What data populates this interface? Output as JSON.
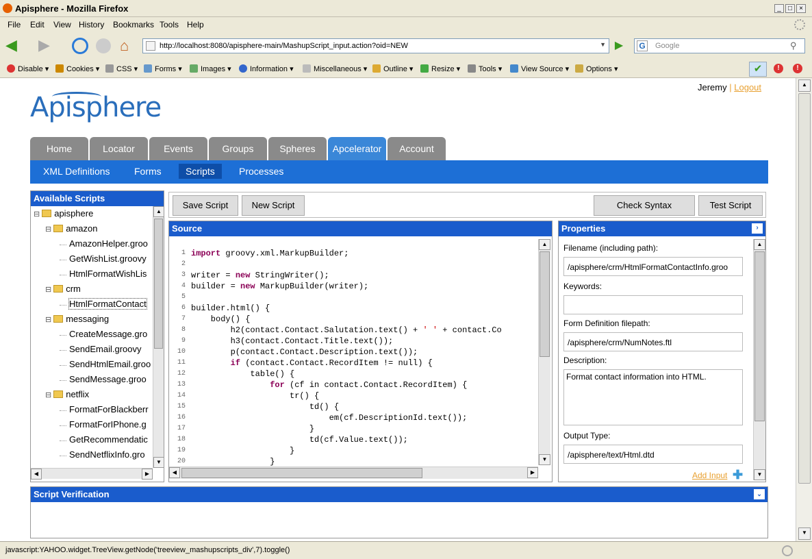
{
  "window": {
    "title": "Apisphere - Mozilla Firefox"
  },
  "menubar": [
    "File",
    "Edit",
    "View",
    "History",
    "Bookmarks",
    "Tools",
    "Help"
  ],
  "navbar": {
    "url": "http://localhost:8080/apisphere-main/MashupScript_input.action?oid=NEW",
    "search_placeholder": "Google"
  },
  "devbar": [
    "Disable",
    "Cookies",
    "CSS",
    "Forms",
    "Images",
    "Information",
    "Miscellaneous",
    "Outline",
    "Resize",
    "Tools",
    "View Source",
    "Options"
  ],
  "page": {
    "user": "Jeremy",
    "separator": "|",
    "logout": "Logout",
    "logo": "Apisphere",
    "tabs": [
      "Home",
      "Locator",
      "Events",
      "Groups",
      "Spheres",
      "Apcelerator",
      "Account"
    ],
    "active_tab": "Apcelerator",
    "subnav": [
      "XML Definitions",
      "Forms",
      "Scripts",
      "Processes"
    ],
    "active_sub": "Scripts"
  },
  "scripts_panel": {
    "title": "Available Scripts",
    "tree": [
      {
        "label": "apisphere",
        "level": 0,
        "folder": true
      },
      {
        "label": "amazon",
        "level": 1,
        "folder": true
      },
      {
        "label": "AmazonHelper.groo",
        "level": 2,
        "folder": false
      },
      {
        "label": "GetWishList.groovy",
        "level": 2,
        "folder": false
      },
      {
        "label": "HtmlFormatWishLis",
        "level": 2,
        "folder": false
      },
      {
        "label": "crm",
        "level": 1,
        "folder": true
      },
      {
        "label": "HtmlFormatContact",
        "level": 2,
        "folder": false,
        "selected": true
      },
      {
        "label": "messaging",
        "level": 1,
        "folder": true
      },
      {
        "label": "CreateMessage.gro",
        "level": 2,
        "folder": false
      },
      {
        "label": "SendEmail.groovy",
        "level": 2,
        "folder": false
      },
      {
        "label": "SendHtmlEmail.groo",
        "level": 2,
        "folder": false
      },
      {
        "label": "SendMessage.groo",
        "level": 2,
        "folder": false
      },
      {
        "label": "netflix",
        "level": 1,
        "folder": true
      },
      {
        "label": "FormatForBlackberr",
        "level": 2,
        "folder": false
      },
      {
        "label": "FormatForIPhone.g",
        "level": 2,
        "folder": false
      },
      {
        "label": "GetRecommendatic",
        "level": 2,
        "folder": false
      },
      {
        "label": "SendNetflixInfo.gro",
        "level": 2,
        "folder": false
      }
    ]
  },
  "toolbar": {
    "save": "Save Script",
    "new": "New Script",
    "check": "Check Syntax",
    "test": "Test Script"
  },
  "source": {
    "title": "Source",
    "lines": [
      {
        "n": "1",
        "t": "import groovy.xml.MarkupBuilder;"
      },
      {
        "n": "2",
        "t": ""
      },
      {
        "n": "3",
        "t": "writer = new StringWriter();"
      },
      {
        "n": "4",
        "t": "builder = new MarkupBuilder(writer);"
      },
      {
        "n": "5",
        "t": ""
      },
      {
        "n": "6",
        "t": "builder.html() {"
      },
      {
        "n": "7",
        "t": "    body() {"
      },
      {
        "n": "8",
        "t": "        h2(contact.Contact.Salutation.text() + ' ' + contact.Co"
      },
      {
        "n": "9",
        "t": "        h3(contact.Contact.Title.text());"
      },
      {
        "n": "10",
        "t": "        p(contact.Contact.Description.text());"
      },
      {
        "n": "11",
        "t": "        if (contact.Contact.RecordItem != null) {"
      },
      {
        "n": "12",
        "t": "            table() {"
      },
      {
        "n": "13",
        "t": "                for (cf in contact.Contact.RecordItem) {"
      },
      {
        "n": "14",
        "t": "                    tr() {"
      },
      {
        "n": "15",
        "t": "                        td() {"
      },
      {
        "n": "16",
        "t": "                            em(cf.DescriptionId.text());"
      },
      {
        "n": "17",
        "t": "                        }"
      },
      {
        "n": "18",
        "t": "                        td(cf.Value.text());"
      },
      {
        "n": "19",
        "t": "                    }"
      },
      {
        "n": "20",
        "t": "                }"
      }
    ]
  },
  "properties": {
    "title": "Properties",
    "filename_label": "Filename (including path):",
    "filename": "/apisphere/crm/HtmlFormatContactInfo.groo",
    "keywords_label": "Keywords:",
    "keywords": "",
    "formdef_label": "Form Definition filepath:",
    "formdef": "/apisphere/crm/NumNotes.ftl",
    "desc_label": "Description:",
    "desc": "Format contact information into HTML.",
    "output_label": "Output Type:",
    "output": "/apisphere/text/Html.dtd",
    "add_input": "Add Input"
  },
  "verification": {
    "title": "Script Verification"
  },
  "status": {
    "text": "javascript:YAHOO.widget.TreeView.getNode('treeview_mashupscripts_div',7).toggle()"
  },
  "colors": {
    "tab_inactive": "#8a8a8a",
    "tab_active": "#3a87d8",
    "subnav": "#1d6fd6",
    "panel_header": "#1a5ccc",
    "logout": "#e8a030"
  }
}
